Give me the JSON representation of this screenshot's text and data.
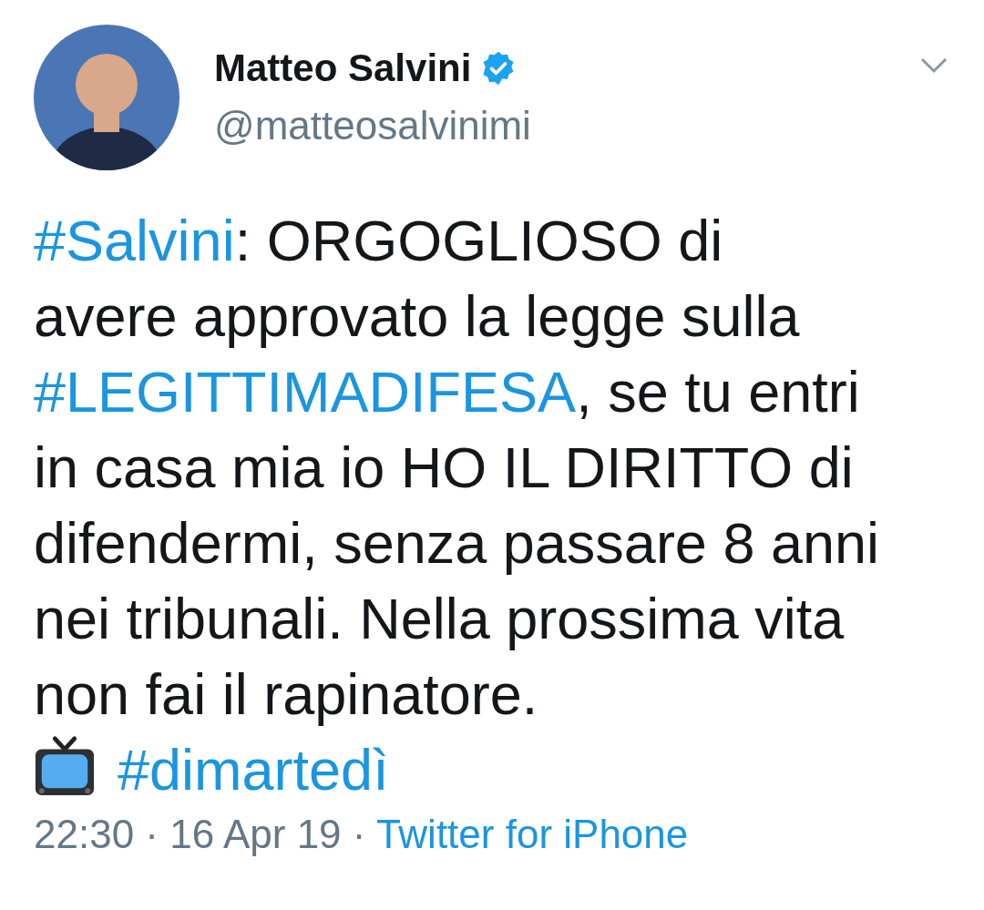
{
  "author": {
    "name": "Matteo Salvini",
    "verified": true,
    "handle": "@matteosalvinimi"
  },
  "body": [
    [
      {
        "kind": "hashtag",
        "text": "#Salvini"
      },
      {
        "kind": "text",
        "text": ": ORGOGLIOSO di"
      }
    ],
    [
      {
        "kind": "text",
        "text": "avere approvato la legge sulla"
      }
    ],
    [
      {
        "kind": "hashtag",
        "text": "#LEGITTIMADIFESA"
      },
      {
        "kind": "text",
        "text": ", se tu entri"
      }
    ],
    [
      {
        "kind": "text",
        "text": "in casa mia io HO IL DIRITTO di"
      }
    ],
    [
      {
        "kind": "text",
        "text": "difendermi, senza passare 8 anni"
      }
    ],
    [
      {
        "kind": "text",
        "text": "nei tribunali. Nella prossima vita"
      }
    ],
    [
      {
        "kind": "text",
        "text": "non fai il rapinatore."
      }
    ],
    [
      {
        "kind": "tv"
      },
      {
        "kind": "hashtag",
        "text": "#dimartedì"
      }
    ]
  ],
  "footer": {
    "meta": "22:30 · 16 Apr 19 ·",
    "source": "Twitter for iPhone"
  }
}
